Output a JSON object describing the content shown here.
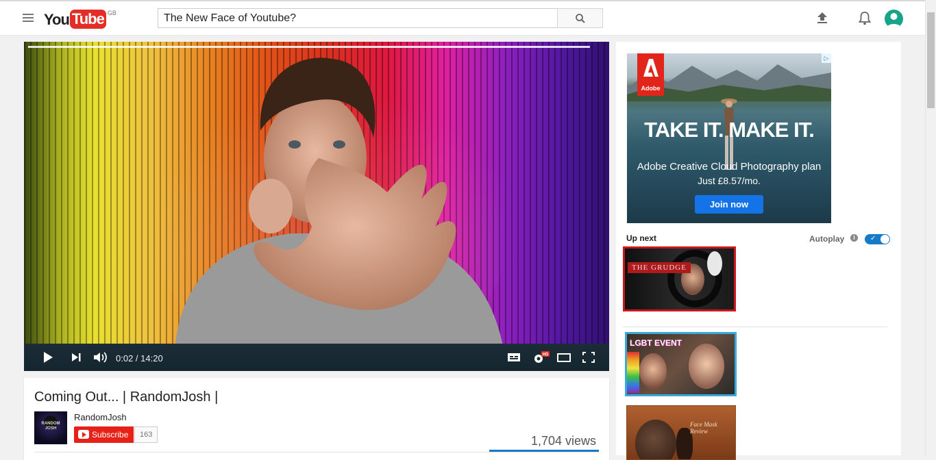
{
  "header": {
    "logo_you": "You",
    "logo_tube": "Tube",
    "region": "GB",
    "search_value": "The New Face of Youtube?",
    "icons": [
      "menu-icon",
      "search-icon",
      "upload-icon",
      "bell-icon",
      "avatar"
    ]
  },
  "player": {
    "time": "0:02 / 14:20",
    "progress_fraction": 0.0023,
    "hd_badge": "HD",
    "icons": [
      "play-icon",
      "next-icon",
      "volume-icon",
      "captions-icon",
      "settings-icon",
      "theater-icon",
      "fullscreen-icon"
    ]
  },
  "video": {
    "title": "Coming Out... | RandomJosh |",
    "channel": "RandomJosh",
    "channel_thumb_text": "RANDOM JOSH",
    "subscribe_label": "Subscribe",
    "subscriber_count": "163",
    "views": "1,704 views"
  },
  "ad": {
    "brand": "Adobe",
    "headline": "TAKE IT. MAKE IT.",
    "line1": "Adobe Creative Cloud Photography plan",
    "line2": "Just £8.57/mo.",
    "cta": "Join now",
    "adchoices": "▷"
  },
  "sidebar": {
    "upnext_label": "Up next",
    "autoplay_label": "Autoplay",
    "autoplay_on": true,
    "thumbs": [
      {
        "tag": "THE GRUDGE"
      },
      {
        "tag": "LGBT EVENT"
      },
      {
        "tag": "Face Mask Review"
      }
    ]
  },
  "colors": {
    "brand_red": "#e52d27",
    "accent_blue": "#167ac6"
  }
}
